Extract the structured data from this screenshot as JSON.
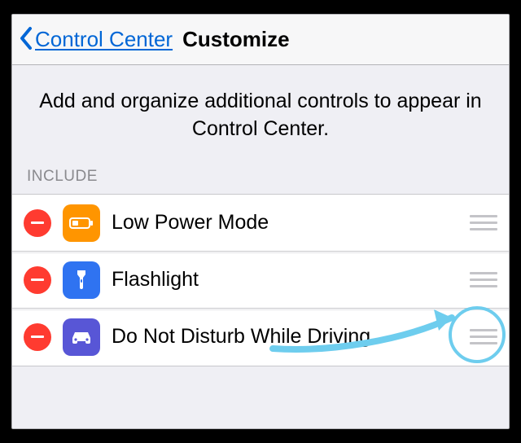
{
  "nav": {
    "back_label": "Control Center",
    "title": "Customize"
  },
  "description": "Add and organize additional controls to appear in Control Center.",
  "section_header": "INCLUDE",
  "rows": [
    {
      "label": "Low Power Mode",
      "icon": "battery-low-icon",
      "icon_bg": "#ff9500"
    },
    {
      "label": "Flashlight",
      "icon": "flashlight-icon",
      "icon_bg": "#2f73f1"
    },
    {
      "label": "Do Not Disturb While Driving",
      "icon": "car-icon",
      "icon_bg": "#5856d6"
    }
  ],
  "annotation": {
    "highlight_color": "#6ecdee",
    "target": "drag-handle"
  }
}
